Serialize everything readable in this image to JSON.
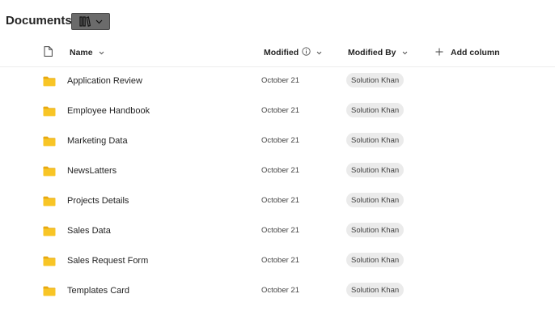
{
  "header": {
    "title": "Documents"
  },
  "columns": {
    "name": "Name",
    "modified": "Modified",
    "modified_by": "Modified By",
    "add_column": "Add column"
  },
  "rows": [
    {
      "name": "Application Review",
      "modified": "October 21",
      "modified_by": "Solution Khan"
    },
    {
      "name": "Employee Handbook",
      "modified": "October 21",
      "modified_by": "Solution Khan"
    },
    {
      "name": "Marketing Data",
      "modified": "October 21",
      "modified_by": "Solution Khan"
    },
    {
      "name": "NewsLatters",
      "modified": "October 21",
      "modified_by": "Solution Khan"
    },
    {
      "name": "Projects Details",
      "modified": "October 21",
      "modified_by": "Solution Khan"
    },
    {
      "name": "Sales Data",
      "modified": "October 21",
      "modified_by": "Solution Khan"
    },
    {
      "name": "Sales Request Form",
      "modified": "October 21",
      "modified_by": "Solution Khan"
    },
    {
      "name": "Templates Card",
      "modified": "October 21",
      "modified_by": "Solution Khan"
    }
  ],
  "icons": {
    "view": "library-view-icon",
    "file_type": "file-type-icon",
    "folder": "folder-icon",
    "info": "info-icon",
    "add": "plus-icon"
  },
  "colors": {
    "folder": "#f5c21b",
    "person_chip": "#ebebeb",
    "view_button": "#6b6b6b"
  }
}
